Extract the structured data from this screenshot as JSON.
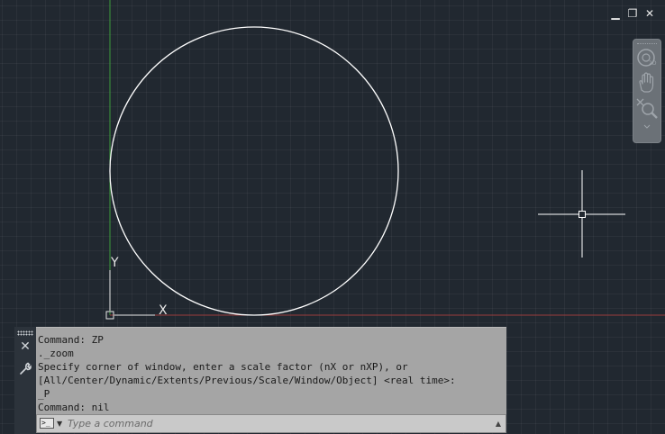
{
  "window_controls": {
    "minimize_glyph": "▁",
    "restore_glyph": "❐",
    "close_glyph": "✕"
  },
  "ucs": {
    "x_label": "X",
    "y_label": "Y"
  },
  "navigation_bar": {
    "tools": [
      "steering-wheel-icon",
      "pan-hand-icon",
      "zoom-magnifier-icon"
    ]
  },
  "command_line": {
    "history": [
      "Command: ZP",
      "._zoom",
      "Specify corner of window, enter a scale factor (nX or nXP), or",
      "[All/Center/Dynamic/Extents/Previous/Scale/Window/Object] <real time>:",
      "_P",
      "Command: nil"
    ],
    "input_placeholder": "Type a command",
    "input_value": "",
    "close_glyph": "✕",
    "customize_glyph": "🔧"
  },
  "colors": {
    "canvas_background": "#212830",
    "grid_line": "#2d343c",
    "y_axis": "#3d9a3d",
    "x_axis": "#9a3d3d",
    "geometry": "#ffffff",
    "command_history_bg": "#a5a5a5"
  }
}
